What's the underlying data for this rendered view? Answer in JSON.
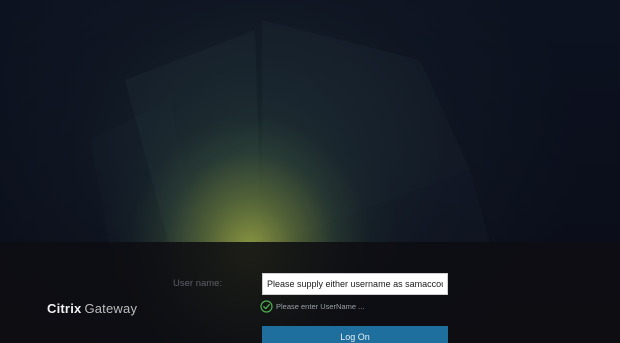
{
  "brand": {
    "name_bold": "Citrix",
    "name_light": "Gateway"
  },
  "form": {
    "username_label": "User name:",
    "username_value": "Please supply either username as samaccountnam",
    "validation_icon": "check-circle-icon",
    "validation_message": "Please enter UserName ...",
    "logon_label": "Log On"
  },
  "colors": {
    "button": "#1f6f9e",
    "validation_ok": "#4caf50"
  }
}
